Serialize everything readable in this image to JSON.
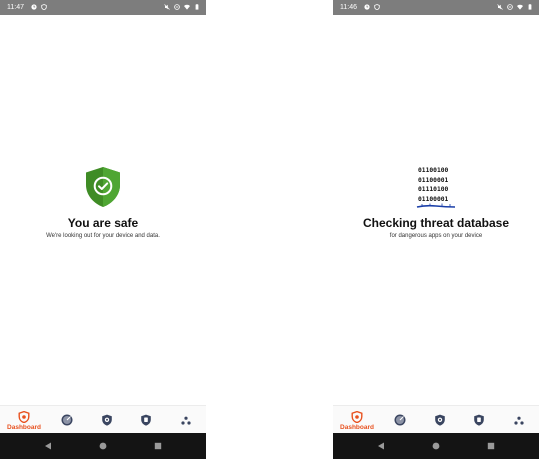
{
  "screens": [
    {
      "status": {
        "time": "11:47"
      },
      "title": "You are safe",
      "subtitle": "We're looking out for your device and data.",
      "nav": {
        "dashboard_label": "Dashboard"
      }
    },
    {
      "status": {
        "time": "11:46"
      },
      "binary": [
        "01100100",
        "01100001",
        "01110100",
        "01100001"
      ],
      "title": "Checking threat database",
      "subtitle": "for dangerous apps on your device",
      "nav": {
        "dashboard_label": "Dashboard"
      }
    }
  ],
  "colors": {
    "status_bar": "#7d7d7d",
    "shield_green": "#4a9a2c",
    "accent_orange": "#e8511f",
    "nav_icon": "#3a4560",
    "system_nav": "#141414"
  },
  "icons": {
    "shield": "shield-check-icon",
    "nav": [
      "dashboard-shield-icon",
      "scan-radar-icon",
      "privacy-shield-icon",
      "security-shield-icon",
      "more-dots-icon"
    ],
    "system": [
      "back-icon",
      "home-icon",
      "recents-icon"
    ]
  }
}
